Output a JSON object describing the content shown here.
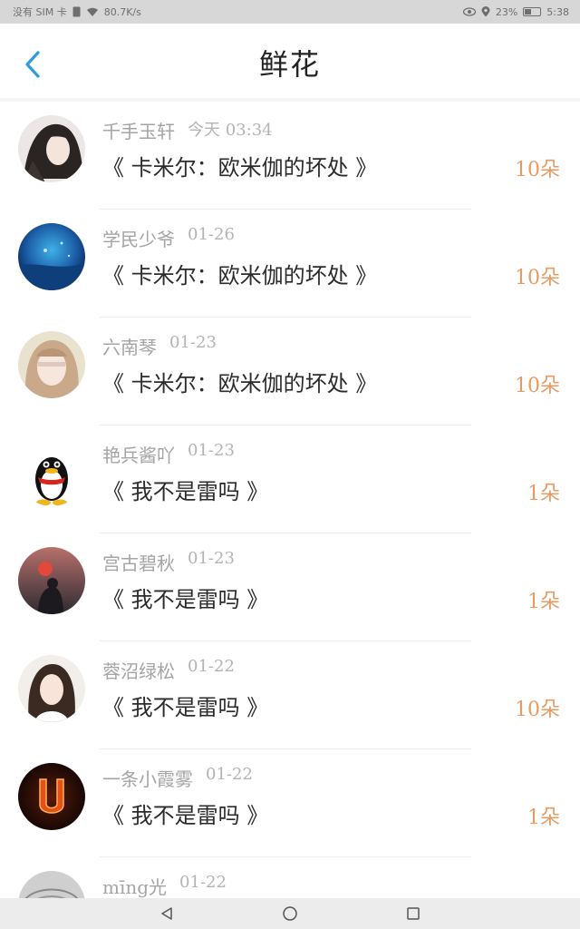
{
  "status_bar": {
    "carrier": "没有 SIM 卡",
    "speed": "80.7K/s",
    "battery": "23%",
    "time": "5:38"
  },
  "header": {
    "title": "鲜花"
  },
  "items": [
    {
      "name": "千手玉轩",
      "time": "今天 03:34",
      "subject": "《 卡米尔：欧米伽的坏处 》",
      "count": "10朵"
    },
    {
      "name": "学民少爷",
      "time": "01-26",
      "subject": "《 卡米尔：欧米伽的坏处 》",
      "count": "10朵"
    },
    {
      "name": "六南琴",
      "time": "01-23",
      "subject": "《 卡米尔：欧米伽的坏处 》",
      "count": "10朵"
    },
    {
      "name": "艳兵酱吖",
      "time": "01-23",
      "subject": "《 我不是雷吗 》",
      "count": "1朵"
    },
    {
      "name": "宫古碧秋",
      "time": "01-23",
      "subject": "《 我不是雷吗 》",
      "count": "1朵"
    },
    {
      "name": "蓉沼绿松",
      "time": "01-22",
      "subject": "《 我不是雷吗 》",
      "count": "10朵"
    },
    {
      "name": "一条小霞雾",
      "time": "01-22",
      "subject": "《 我不是雷吗 》",
      "count": "1朵"
    },
    {
      "name": "mīng光",
      "time": "01-22",
      "subject": "",
      "count": ""
    }
  ],
  "colors": {
    "accent": "#2e9cdc",
    "count": "#e69b62"
  }
}
